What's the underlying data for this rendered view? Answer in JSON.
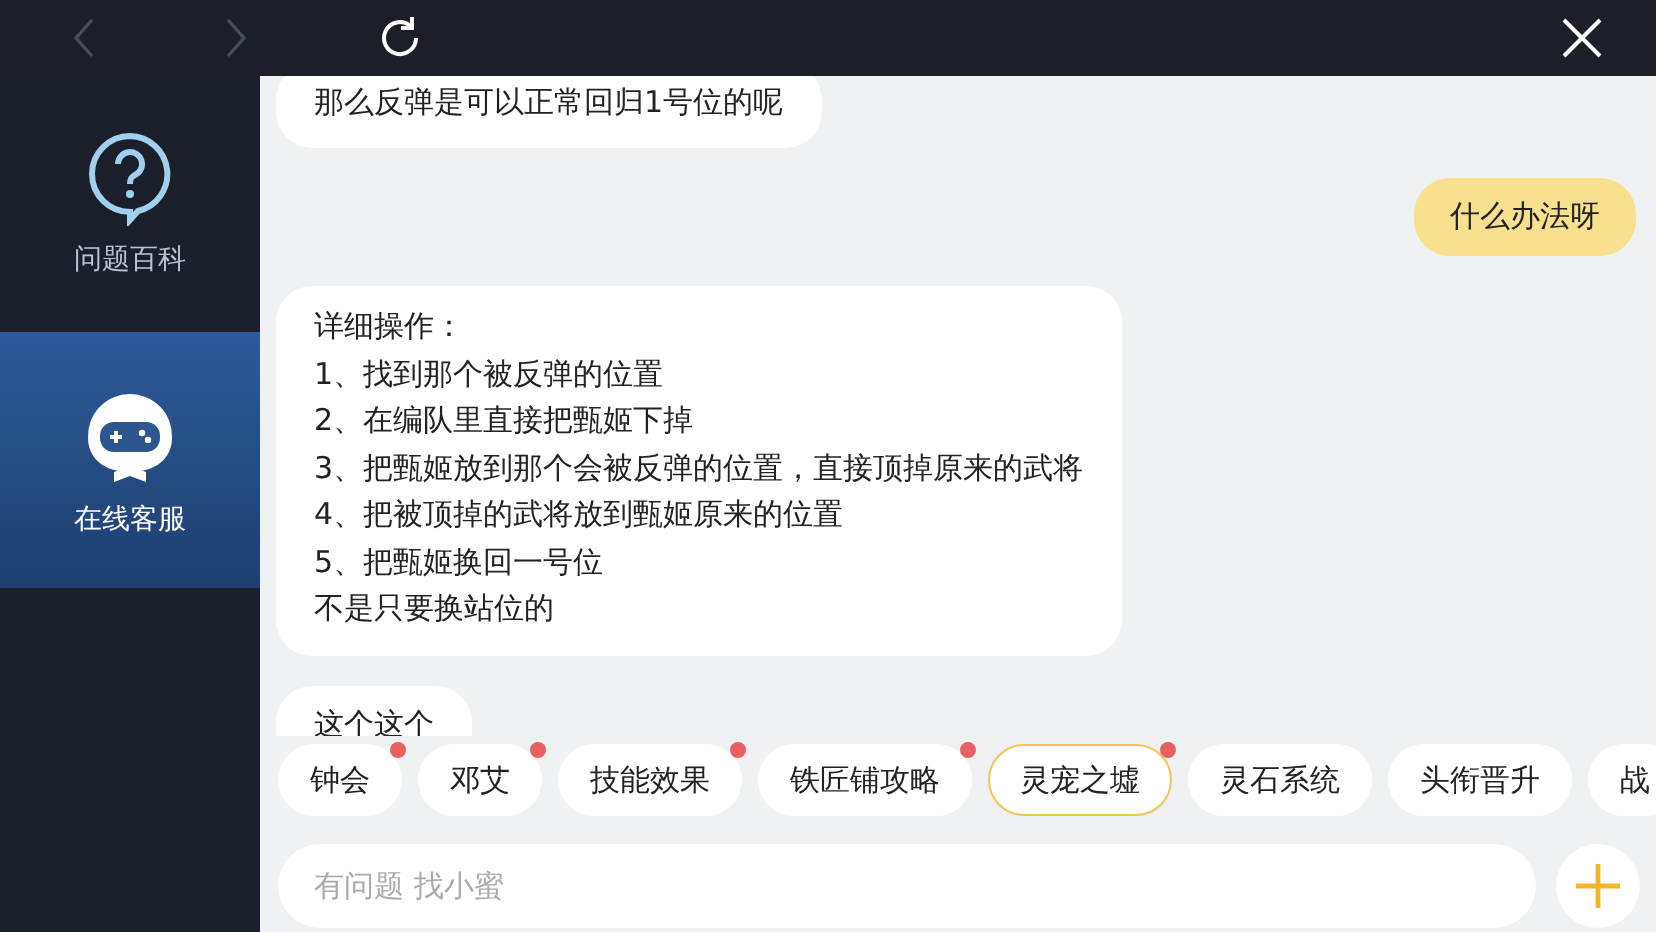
{
  "toolbar": {
    "back_disabled": true,
    "forward_disabled": true
  },
  "sidebar": {
    "items": [
      {
        "kind": "faq",
        "label": "问题百科",
        "selected": false
      },
      {
        "kind": "service",
        "label": "在线客服",
        "selected": true
      }
    ]
  },
  "messages": [
    {
      "kind": "incoming",
      "lines": [
        "那么反弹是可以正常回归1号位的呢"
      ]
    },
    {
      "kind": "outgoing",
      "lines": [
        "什么办法呀"
      ]
    },
    {
      "kind": "incoming",
      "lines": [
        "详细操作：",
        "1、找到那个被反弹的位置",
        "2、在编队里直接把甄姬下掉",
        "3、把甄姬放到那个会被反弹的位置，直接顶掉原来的武将",
        "4、把被顶掉的武将放到甄姬原来的位置",
        "5、把甄姬换回一号位",
        "不是只要换站位的"
      ]
    },
    {
      "kind": "incoming",
      "lines": [
        "这个这个"
      ]
    }
  ],
  "chips": [
    {
      "label": "钟会",
      "dot": true,
      "selected": false
    },
    {
      "label": "邓艾",
      "dot": true,
      "selected": false
    },
    {
      "label": "技能效果",
      "dot": true,
      "selected": false
    },
    {
      "label": "铁匠铺攻略",
      "dot": true,
      "selected": false
    },
    {
      "label": "灵宠之墟",
      "dot": true,
      "selected": true
    },
    {
      "label": "灵石系统",
      "dot": false,
      "selected": false
    },
    {
      "label": "头衔晋升",
      "dot": false,
      "selected": false
    },
    {
      "label": "战",
      "dot": false,
      "selected": false
    }
  ],
  "input": {
    "placeholder": "有问题 找小蜜"
  }
}
